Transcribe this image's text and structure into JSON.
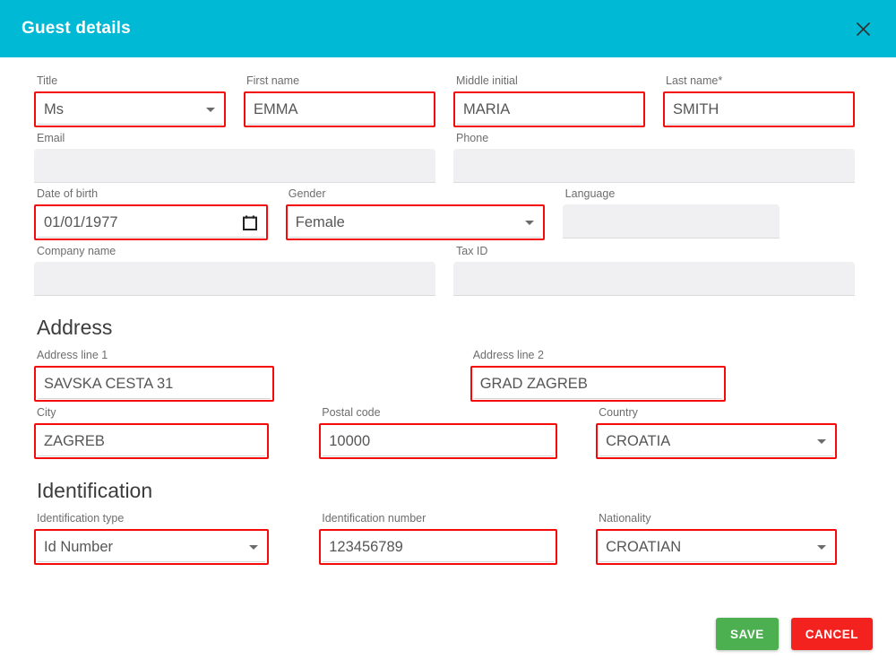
{
  "header": {
    "title": "Guest details",
    "close_icon": "close-icon",
    "bg_color": "#00b9d4"
  },
  "sections": {
    "address_heading": "Address",
    "identification_heading": "Identification"
  },
  "fields": {
    "title": {
      "label": "Title",
      "value": "Ms",
      "type": "select"
    },
    "first_name": {
      "label": "First name",
      "value": "EMMA",
      "type": "text"
    },
    "middle_initial": {
      "label": "Middle initial",
      "value": "MARIA",
      "type": "text"
    },
    "last_name": {
      "label": "Last name*",
      "value": "SMITH",
      "type": "text"
    },
    "email": {
      "label": "Email",
      "value": "",
      "type": "text"
    },
    "phone": {
      "label": "Phone",
      "value": "",
      "type": "text"
    },
    "date_of_birth": {
      "label": "Date of birth",
      "value": "01/01/1977",
      "type": "date",
      "icon": "calendar-icon"
    },
    "gender": {
      "label": "Gender",
      "value": "Female",
      "type": "select"
    },
    "language": {
      "label": "Language",
      "value": "",
      "type": "text"
    },
    "company_name": {
      "label": "Company name",
      "value": "",
      "type": "text"
    },
    "tax_id": {
      "label": "Tax ID",
      "value": "",
      "type": "text"
    },
    "address_line_1": {
      "label": "Address line 1",
      "value": "SAVSKA CESTA 31",
      "type": "text"
    },
    "address_line_2": {
      "label": "Address line 2",
      "value": "GRAD ZAGREB",
      "type": "text"
    },
    "city": {
      "label": "City",
      "value": "ZAGREB",
      "type": "text"
    },
    "postal_code": {
      "label": "Postal code",
      "value": "10000",
      "type": "text"
    },
    "country": {
      "label": "Country",
      "value": "CROATIA",
      "type": "select"
    },
    "identification_type": {
      "label": "Identification type",
      "value": "Id Number",
      "type": "select"
    },
    "identification_number": {
      "label": "Identification number",
      "value": "123456789",
      "type": "text"
    },
    "nationality": {
      "label": "Nationality",
      "value": "CROATIAN",
      "type": "select"
    }
  },
  "footer": {
    "save_label": "SAVE",
    "cancel_label": "CANCEL",
    "save_color": "#4caf50",
    "cancel_color": "#f4221f"
  },
  "validation": {
    "highlight_color": "#f50a0a"
  }
}
